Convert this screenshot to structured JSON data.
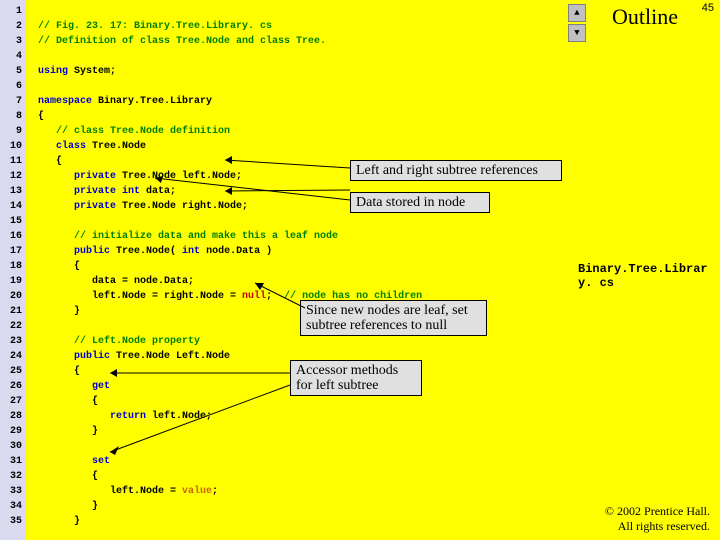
{
  "page": {
    "number": "45",
    "outline": "Outline"
  },
  "file": {
    "label": "Binary.Tree.Librar\ny. cs"
  },
  "copyright": {
    "line1": "© 2002 Prentice Hall.",
    "line2": "All rights reserved."
  },
  "gutter": {
    "lines": [
      "1",
      "2",
      "3",
      "4",
      "5",
      "6",
      "7",
      "8",
      "9",
      "10",
      "11",
      "12",
      "13",
      "14",
      "15",
      "16",
      "17",
      "18",
      "19",
      "20",
      "21",
      "22",
      "23",
      "24",
      "25",
      "26",
      "27",
      "28",
      "29",
      "30",
      "31",
      "32",
      "33",
      "34",
      "35"
    ]
  },
  "code": {
    "l1_a": "// Fig. 23. 17: Binary.Tree.Library. cs",
    "l2_a": "// Definition of class Tree.Node and class Tree.",
    "l4_a": "using ",
    "l4_b": "System;",
    "l6_a": "namespace ",
    "l6_b": "Binary.Tree.Library",
    "l7_a": "{",
    "l8_a": "   ",
    "l8_b": "// class Tree.Node definition",
    "l9_a": "   ",
    "l9_b": "class ",
    "l9_c": "Tree.Node",
    "l10_a": "   {",
    "l11_a": "      ",
    "l11_b": "private ",
    "l11_c": "Tree.Node left.Node;",
    "l12_a": "      ",
    "l12_b": "private int ",
    "l12_c": "data;",
    "l13_a": "      ",
    "l13_b": "private ",
    "l13_c": "Tree.Node right.Node;",
    "l15_a": "      ",
    "l15_b": "// initialize data and make this a leaf node",
    "l16_a": "      ",
    "l16_b": "public ",
    "l16_c": "Tree.Node( ",
    "l16_d": "int ",
    "l16_e": "node.Data )",
    "l17_a": "      {",
    "l18_a": "         data = node.Data;",
    "l19_a": "         left.Node = right.Node = ",
    "l19_b": "null",
    "l19_c": ";  ",
    "l19_d": "// node has no children",
    "l20_a": "      }",
    "l22_a": "      ",
    "l22_b": "// Left.Node property",
    "l23_a": "      ",
    "l23_b": "public ",
    "l23_c": "Tree.Node Left.Node",
    "l24_a": "      {",
    "l25_a": "         ",
    "l25_b": "get",
    "l26_a": "         {",
    "l27_a": "            ",
    "l27_b": "return ",
    "l27_c": "left.Node;",
    "l28_a": "         }",
    "l30_a": "         ",
    "l30_b": "set",
    "l31_a": "         {",
    "l32_a": "            left.Node = ",
    "l32_b": "value",
    "l32_c": ";",
    "l33_a": "         }",
    "l34_a": "      }"
  },
  "callouts": {
    "c1": "Left and right subtree references",
    "c2": "Data stored in node",
    "c3": "Since new nodes are leaf, set\nsubtree references to null",
    "c4": "Accessor methods\nfor left subtree"
  }
}
